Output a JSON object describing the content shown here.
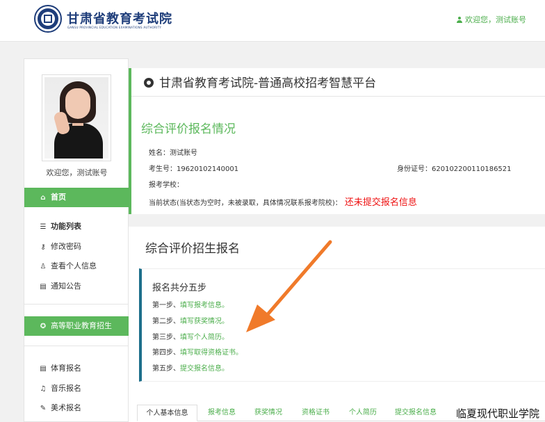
{
  "header": {
    "title": "甘肃省教育考试院",
    "subtitle": "GANSU PROVINCIAL EDUCATION EXAMINATIONS AUTHORITY",
    "welcome": "欢迎您，测试账号"
  },
  "sidebar": {
    "avatar_caption": "欢迎您，测试账号",
    "home": "首页",
    "func_list": "功能列表",
    "items": [
      "修改密码",
      "查看个人信息",
      "通知公告"
    ],
    "vocational": "高等职业教育招生",
    "sub_items": [
      "体育报名",
      "音乐报名",
      "美术报名"
    ]
  },
  "main": {
    "title": "甘肃省教育考试院-普通高校招考智慧平台",
    "section1_title": "综合评价报名情况",
    "name": "姓名：测试账号",
    "exam_no": "考生号：19620102140001",
    "id_no": "身份证号：620102200110186521",
    "school": "报考学校：",
    "status_label": "当前状态(当状态为空时，未被录取，具体情况联系报考院校)：",
    "status_value": "还未提交报名信息",
    "section2_title": "综合评价招生报名",
    "steps_head": "报名共分五步",
    "steps": [
      {
        "prefix": "第一步、",
        "link": "填写报考信息。"
      },
      {
        "prefix": "第二步、",
        "link": "填写获奖情况。"
      },
      {
        "prefix": "第三步、",
        "link": "填写个人简历。"
      },
      {
        "prefix": "第四步、",
        "link": "填写取得资格证书。"
      },
      {
        "prefix": "第五步、",
        "link": "提交报名信息。"
      }
    ],
    "tabs": [
      "个人基本信息",
      "报考信息",
      "获奖情况",
      "资格证书",
      "个人简历",
      "提交报名信息"
    ]
  },
  "watermark": "临夏现代职业学院",
  "colors": {
    "accent": "#5cb85c",
    "brand": "#1e3d7a",
    "status": "#ee1111",
    "arrow": "#f07a2a",
    "steps_border": "#1d6f8b"
  }
}
